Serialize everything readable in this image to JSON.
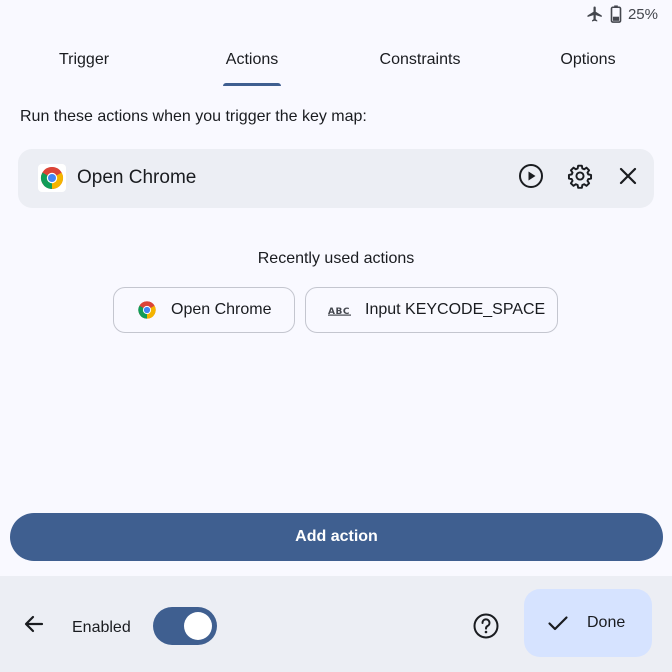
{
  "status_bar": {
    "battery_text": "25%",
    "icons": [
      "airplane-icon",
      "battery-icon"
    ]
  },
  "tabs": [
    {
      "label": "Trigger",
      "selected": false
    },
    {
      "label": "Actions",
      "selected": true
    },
    {
      "label": "Constraints",
      "selected": false
    },
    {
      "label": "Options",
      "selected": false
    }
  ],
  "instructions": "Run these actions when you trigger the key map:",
  "action_card": {
    "icon": "chrome-icon",
    "label": "Open Chrome",
    "buttons": [
      "play-icon",
      "gear-icon",
      "close-icon"
    ]
  },
  "recent": {
    "title": "Recently used actions",
    "chips": [
      {
        "icon": "chrome-icon",
        "label": "Open Chrome"
      },
      {
        "icon": "abc-keyboard-icon",
        "label": "Input KEYCODE_SPACE"
      }
    ]
  },
  "add_action_label": "Add action",
  "bottom_bar": {
    "enabled_label": "Enabled",
    "enabled": true,
    "done_label": "Done"
  },
  "colors": {
    "primary": "#3f5f90",
    "surface": "#f9f9ff",
    "surface_container": "#eceef4",
    "done_container": "#d6e3ff"
  }
}
